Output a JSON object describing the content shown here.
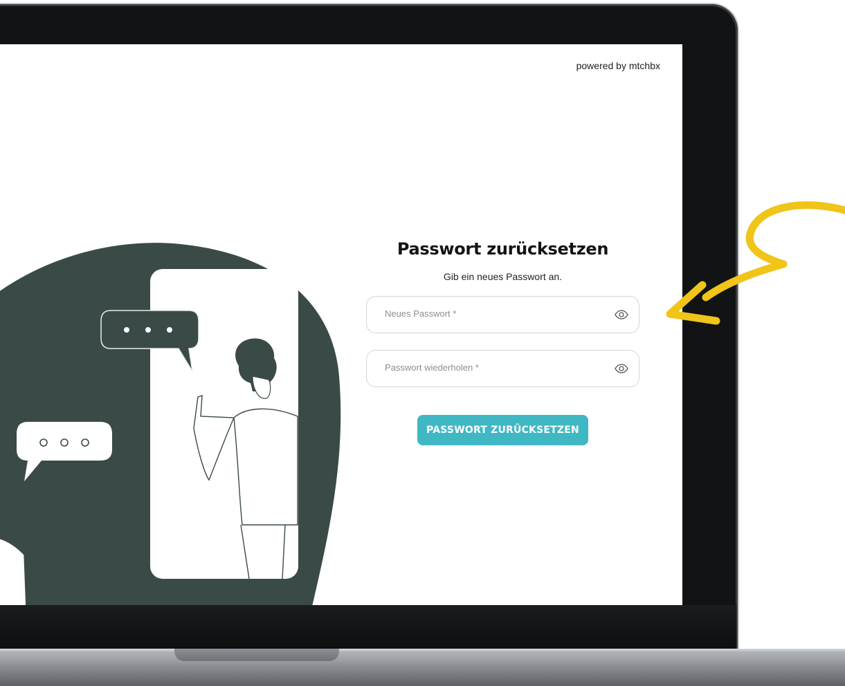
{
  "header": {
    "powered_by": "powered by mtchbx"
  },
  "form": {
    "title": "Passwort zurücksetzen",
    "subtitle": "Gib ein neues Passwort an.",
    "new_password_placeholder": "Neues Passwort *",
    "repeat_password_placeholder": "Passwort wiederholen *",
    "submit_label": "PASSWORT ZURÜCKSETZEN"
  },
  "colors": {
    "accent": "#3fb8c4",
    "illustration_bg": "#3a4a47",
    "annotation_arrow": "#f0c419"
  },
  "icons": {
    "show_password": "eye-icon",
    "annotation": "yellow-arrow-icon"
  }
}
